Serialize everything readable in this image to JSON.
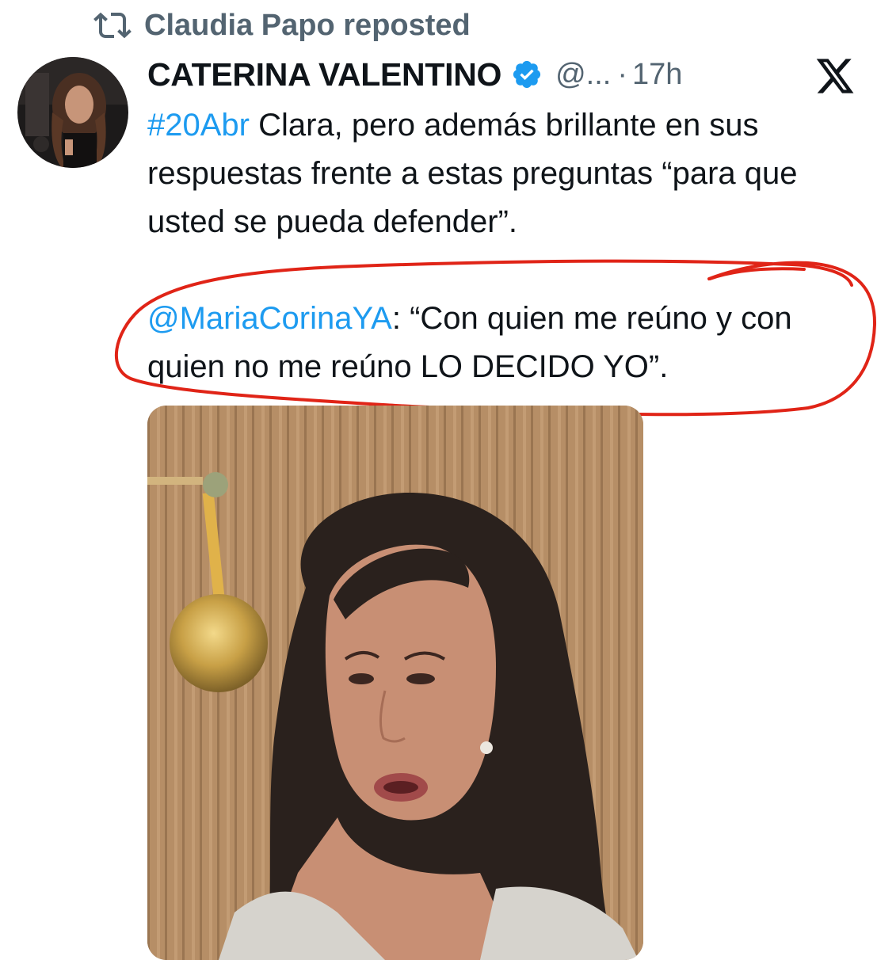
{
  "repost": {
    "icon": "repost-icon",
    "text": "Claudia Papo reposted"
  },
  "tweet": {
    "author_name": "CATERINA VALENTINO",
    "verified_icon": "verified-badge-icon",
    "handle": "@...",
    "separator": "·",
    "time": "17h",
    "platform_icon": "x-logo-icon",
    "text": {
      "hashtag": "#20Abr",
      "line1_rest": " Clara, pero además brillante en sus respuestas frente a estas preguntas “para que usted se pueda defender”.",
      "mention": "@MariaCorinaYA",
      "quote": ": “Con quien me reúno y con quien no me reúno LO DECIDO YO”."
    }
  },
  "colors": {
    "link": "#1d9bf0",
    "secondary_text": "#536471",
    "annotation": "#e02417"
  }
}
